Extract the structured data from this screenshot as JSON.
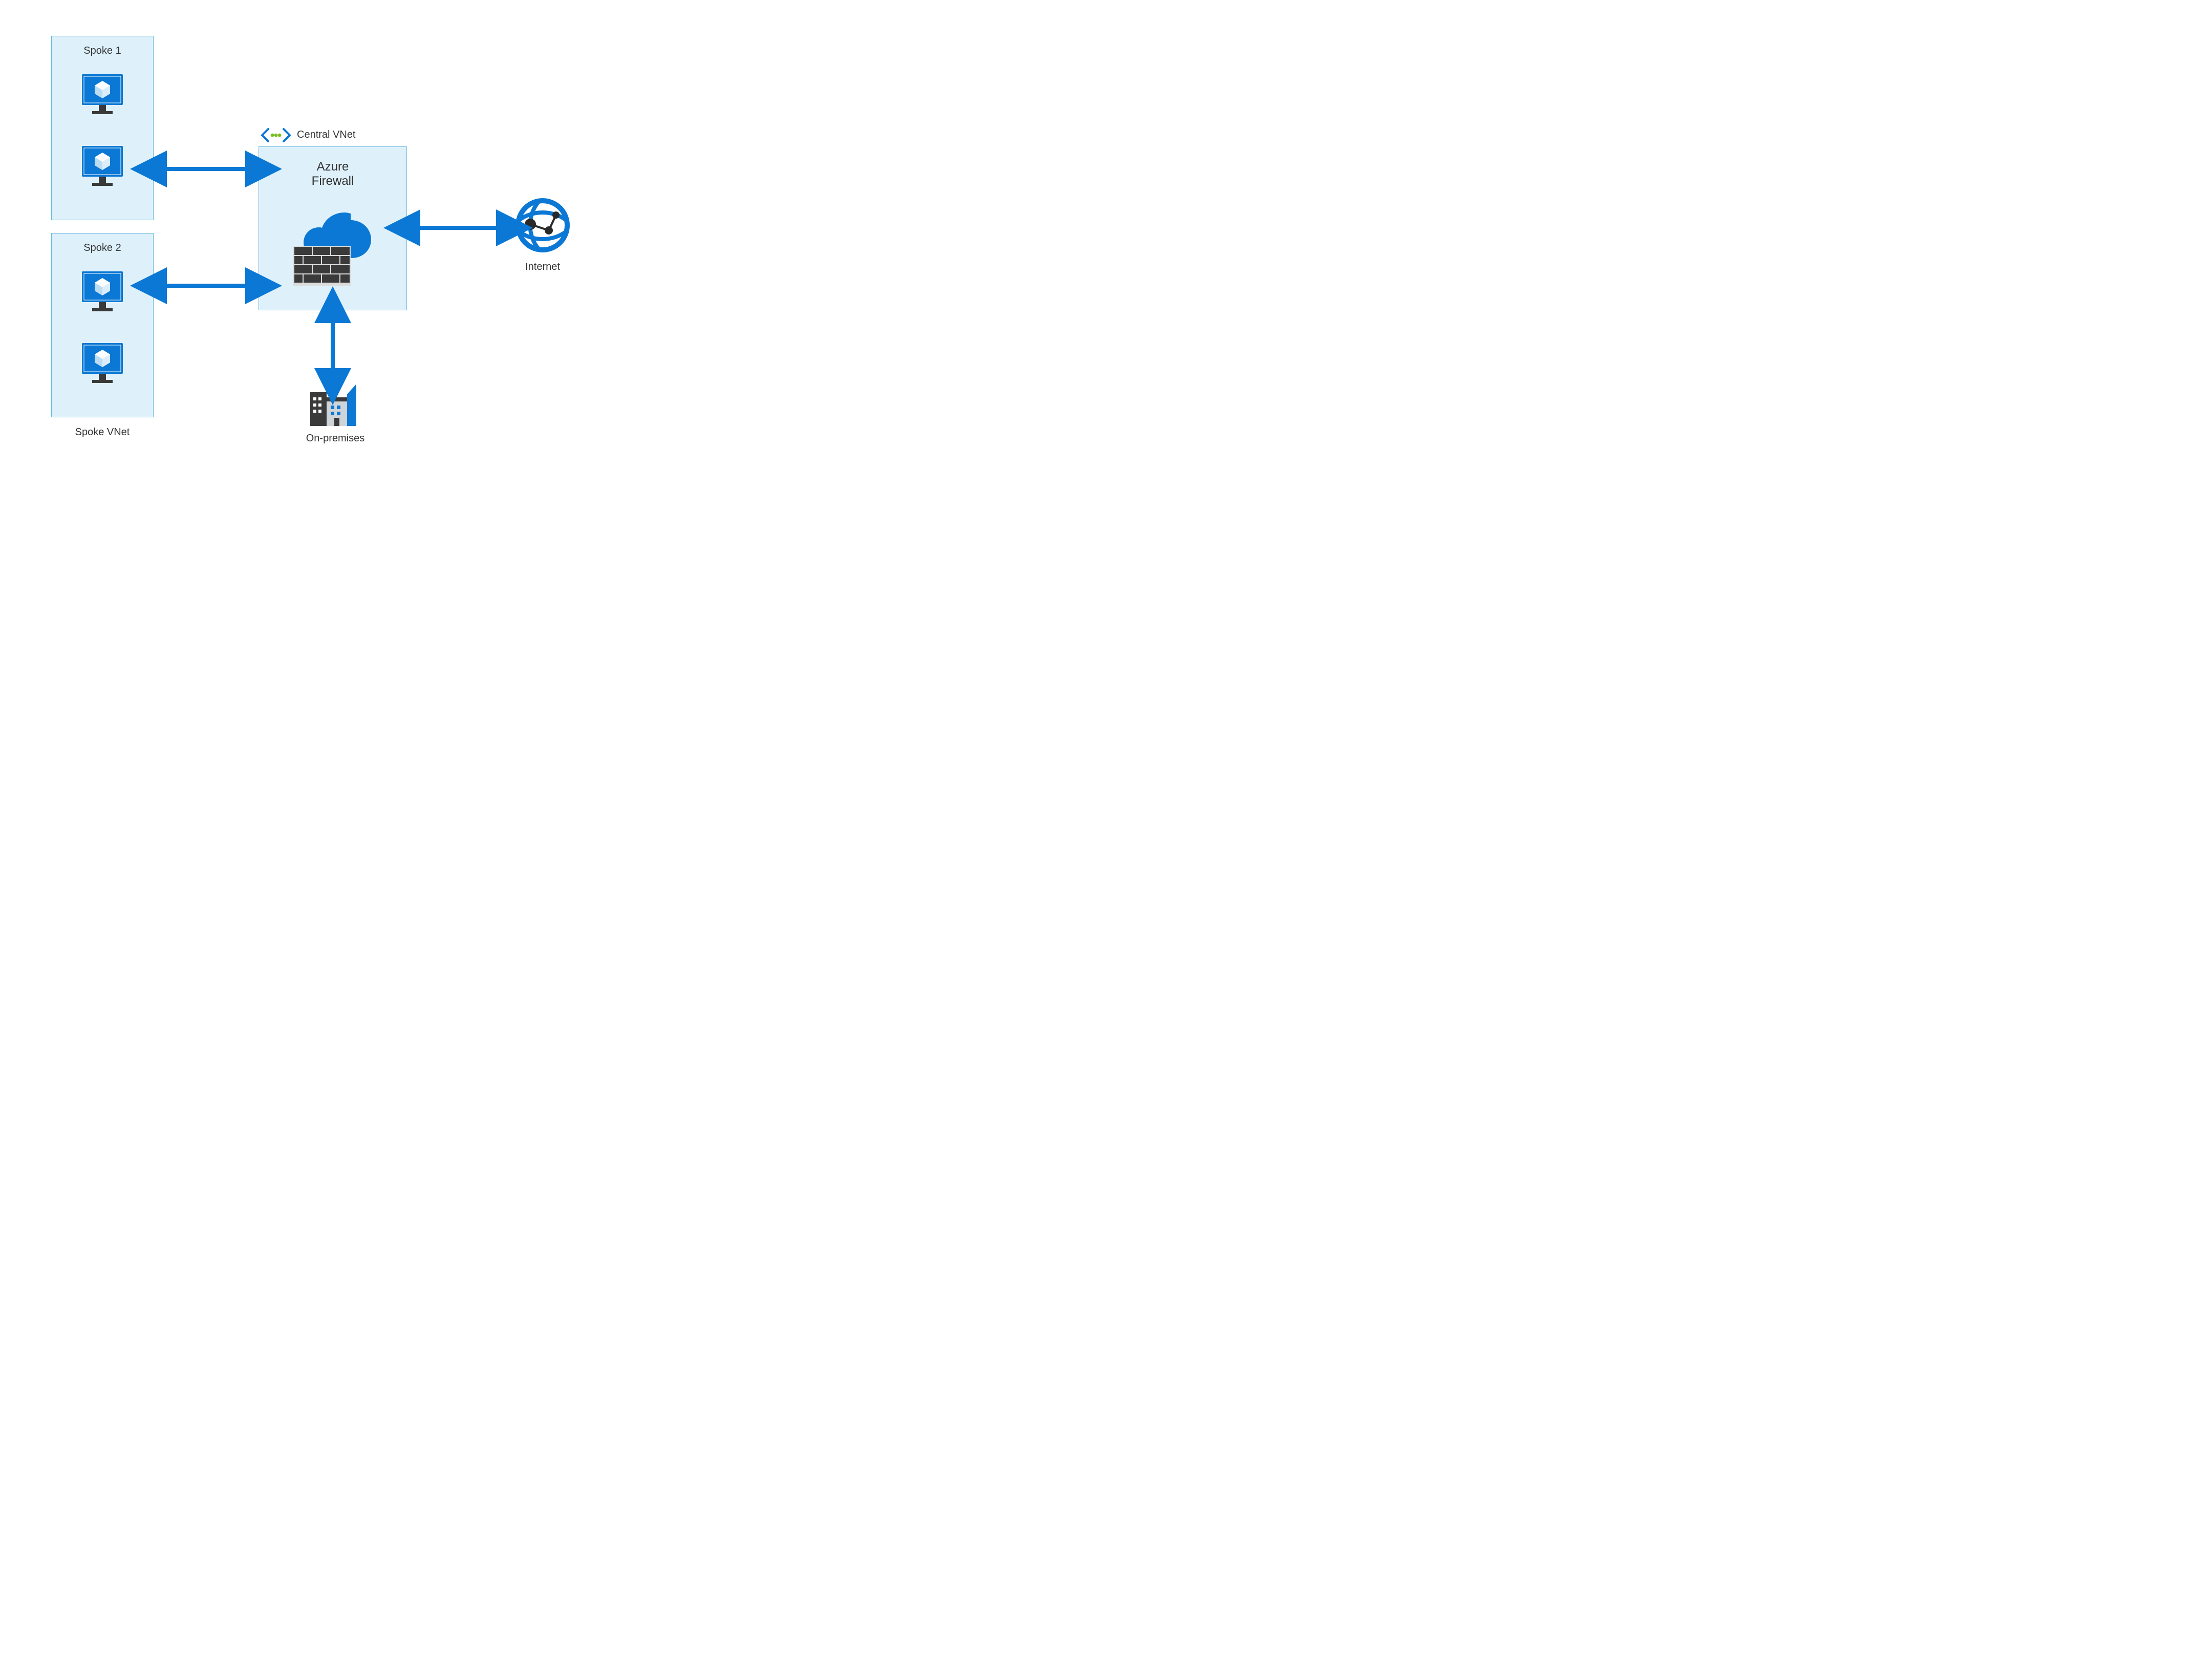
{
  "spoke1": {
    "title": "Spoke 1"
  },
  "spoke2": {
    "title": "Spoke 2"
  },
  "spoke_vnet_caption": "Spoke VNet",
  "central": {
    "header": "Central VNet",
    "title_line1": "Azure",
    "title_line2": "Firewall"
  },
  "onprem_caption": "On-premises",
  "internet_caption": "Internet",
  "colors": {
    "panel_fill": "#def1fb",
    "panel_stroke": "#69b8e0",
    "azure_blue": "#0a78d4",
    "arrow": "#0a78d4",
    "dark": "#3a3a3a",
    "green": "#78bd22"
  }
}
